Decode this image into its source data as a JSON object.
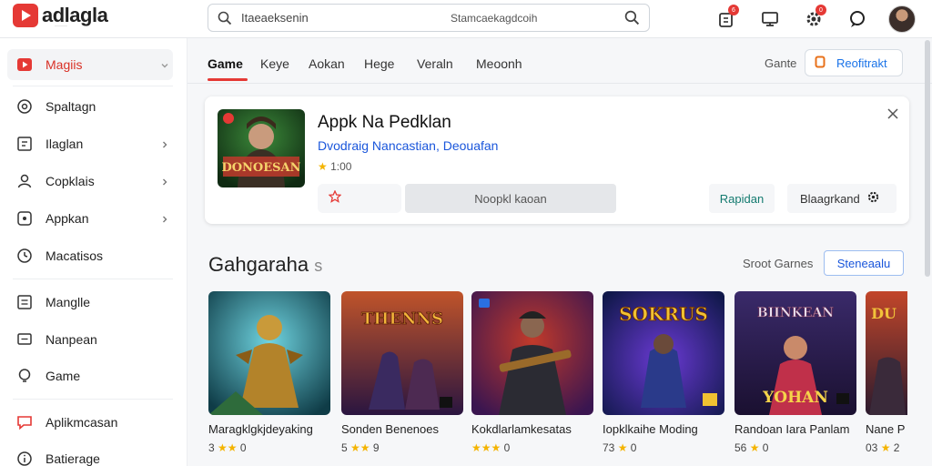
{
  "app": {
    "logo_text": "adlagla",
    "logo_sub": "·······"
  },
  "search": {
    "value": "Itaeaeksenin",
    "hint": "Stamcaekagdcoih"
  },
  "header": {
    "badge1": "6",
    "badge2": "0"
  },
  "sidebar": {
    "items": [
      {
        "label": "Magiis",
        "icon": "play-square-icon"
      },
      {
        "label": "Spaltagn",
        "icon": "circle-dot-icon"
      },
      {
        "label": "Ilaglan",
        "icon": "square-grid-icon"
      },
      {
        "label": "Copklais",
        "icon": "person-icon"
      },
      {
        "label": "Appkan",
        "icon": "app-box-icon"
      },
      {
        "label": "Macatisos",
        "icon": "clock-icon"
      },
      {
        "label": "Manglle",
        "icon": "square-lines-icon"
      },
      {
        "label": "Nanpean",
        "icon": "monitor-icon"
      },
      {
        "label": "Game",
        "icon": "lightbulb-icon"
      },
      {
        "label": "Aplikmcasan",
        "icon": "chat-icon"
      },
      {
        "label": "Batierage",
        "icon": "info-circle-icon"
      }
    ]
  },
  "tabs": {
    "items": [
      "Game",
      "Keye",
      "Aokan",
      "Hege",
      "Veraln",
      "Meoonh"
    ],
    "right_label": "Gante",
    "action_label": "Reofitrakt"
  },
  "featured": {
    "title": "Appk Na Pedklan",
    "subtitle": "Dvodraig Nancastian, Deouafan",
    "rating": "★ 1:00",
    "art_text": "DONOESAN",
    "main_button": "Noopkl kaoan",
    "button_r1": "Rapidan",
    "button_r2": "Blaagrkand"
  },
  "section": {
    "title": "Gahgaraha",
    "title_suffix": "s",
    "link": "Sroot Garnes",
    "button": "Steneaalu"
  },
  "games": [
    {
      "title": "Maragklgkjdeyaking",
      "rating": "3 ★★ 0",
      "art_text": "",
      "colors": [
        "#1b6c7c",
        "#d49a2a"
      ]
    },
    {
      "title": "Sonden Benenoes",
      "rating": "5 ★★ 9",
      "art_text": "THENNS",
      "colors": [
        "#3a1f5c",
        "#c0542a"
      ]
    },
    {
      "title": "Kokdlarlamkesatas",
      "rating": "★★★ 0",
      "art_text": "",
      "colors": [
        "#5a1d6e",
        "#c23a2a"
      ]
    },
    {
      "title": "Iopklkaihe Moding",
      "rating": "73 ★ 0",
      "art_text": "SOKRUS",
      "colors": [
        "#1c2f7a",
        "#e8b33a"
      ]
    },
    {
      "title": "Randoan Iara Panlam",
      "rating": "56 ★ 0",
      "art_text": "YOHAN",
      "colors": [
        "#2a1f55",
        "#d03a6a"
      ]
    },
    {
      "title": "Nane P",
      "rating": "03 ★ 2",
      "art_text": "DU",
      "colors": [
        "#2a1a2e",
        "#c2462a"
      ]
    }
  ],
  "colors": {
    "accent_red": "#e53935",
    "link_blue": "#1a56db",
    "teal": "#137a6f"
  }
}
